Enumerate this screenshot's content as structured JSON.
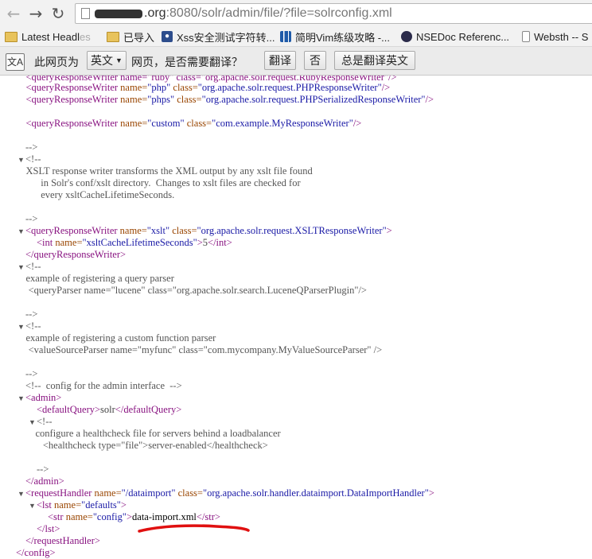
{
  "toolbar": {
    "back_icon": "back-arrow-icon",
    "forward_icon": "forward-arrow-icon",
    "reload_icon": "reload-icon",
    "url_host": ".org",
    "url_path": ":8080/solr/admin/file/?file=solrconfig.xml"
  },
  "bookmarks": [
    {
      "label": "Latest Headl",
      "suffix": "es",
      "icon": "folder-icon"
    },
    {
      "label": "已导入",
      "icon": "folder-icon"
    },
    {
      "label": "Xss安全测试字符转...",
      "icon": "paw-icon"
    },
    {
      "label": "简明Vim练级攻略 -...",
      "icon": "bars-icon"
    },
    {
      "label": "NSEDoc Referenc...",
      "icon": "eye-icon"
    },
    {
      "label": "Websth -- S",
      "icon": "page-icon"
    }
  ],
  "translate": {
    "prefix": "此网页为",
    "language": "英文",
    "question": "网页，是否需要翻译？",
    "translate_btn": "翻译",
    "no_btn": "否",
    "always_btn": "总是翻译英文"
  },
  "xml": {
    "l0": "    <queryResponseWriter name=\"ruby\" class=\"org.apache.solr.request.RubyResponseWriter\"/>",
    "l1a": "    <queryResponseWriter ",
    "l1b": "name=",
    "l1c": "\"php\"",
    "l1d": " class=",
    "l1e": "\"org.apache.solr.request.PHPResponseWriter\"",
    "l1f": "/>",
    "l2c": "\"phps\"",
    "l2e": "\"org.apache.solr.request.PHPSerializedResponseWriter\"",
    "l3c": "\"custom\"",
    "l3e": "\"com.example.MyResponseWriter\"",
    "end_comment": "-->",
    "open_comment": "<!--",
    "xslt_1": "    XSLT response writer transforms the XML output by any xslt file found",
    "xslt_2": "          in Solr's conf/xslt directory.  Changes to xslt files are checked for",
    "xslt_3": "          every xsltCacheLifetimeSeconds.",
    "qrw_open": "<queryResponseWriter",
    "qrw_name_attr": " name=",
    "qrw_name": "\"xslt\"",
    "qrw_class_attr": " class=",
    "qrw_class": "\"org.apache.solr.request.XSLTResponseWriter\"",
    "gt": ">",
    "int_open": "<int",
    "int_name": "\"xsltCacheLifetimeSeconds\"",
    "int_value": "5",
    "int_close": "</int>",
    "qrw_close": "</queryResponseWriter>",
    "qp_1": "    example of registering a query parser",
    "qp_2": "     <queryParser name=\"lucene\" class=\"org.apache.solr.search.LuceneQParserPlugin\"/>",
    "vsp_1": "    example of registering a custom function parser",
    "vsp_2": "     <valueSourceParser name=\"myfunc\" class=\"com.mycompany.MyValueSourceParser\" />",
    "admin_comment": "<!--  config for the admin interface  -->",
    "admin_open": "<admin>",
    "dq_open": "<defaultQuery>",
    "dq_value": "solr",
    "dq_close": "</defaultQuery>",
    "hc_1": "    configure a healthcheck file for servers behind a loadbalancer",
    "hc_2": "       <healthcheck type=\"file\">server-enabled</healthcheck>",
    "admin_close": "</admin>",
    "rh_open": "<requestHandler",
    "rh_name": "\"/dataimport\"",
    "rh_class": "\"org.apache.solr.handler.dataimport.DataImportHandler\"",
    "lst_open": "<lst",
    "lst_name": "\"defaults\"",
    "str_open": "<str",
    "str_name": "\"config\"",
    "str_value": "data-import.xml",
    "str_close": "</str>",
    "lst_close": "</lst>",
    "rh_close": "</requestHandler>",
    "config_close": "</config>",
    "name_attr": "name=",
    "type_val": "\"file\""
  },
  "colors": {
    "tag": "#881280",
    "attr": "#994500",
    "value": "#1a1aa6",
    "annotation": "#e01010"
  }
}
